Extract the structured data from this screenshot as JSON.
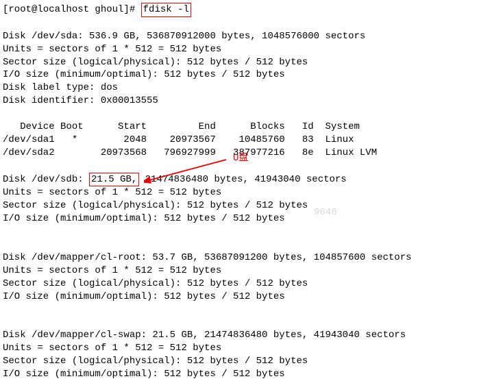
{
  "prompt": {
    "user_host": "[root@localhost ghoul]#",
    "command": "fdisk -l"
  },
  "disk_sda": {
    "header": "Disk /dev/sda: 536.9 GB, 536870912000 bytes, 1048576000 sectors",
    "units": "Units = sectors of 1 * 512 = 512 bytes",
    "sector_size": "Sector size (logical/physical): 512 bytes / 512 bytes",
    "io_size": "I/O size (minimum/optimal): 512 bytes / 512 bytes",
    "label_type": "Disk label type: dos",
    "identifier": "Disk identifier: 0x00013555"
  },
  "partition_table": {
    "header": "   Device Boot      Start         End      Blocks   Id  System",
    "rows": [
      "/dev/sda1   *        2048    20973567    10485760   83  Linux",
      "/dev/sda2        20973568   796927999   387977216   8e  Linux LVM"
    ]
  },
  "disk_sdb": {
    "header_prefix": "Disk /dev/sdb: ",
    "size_highlight": "21.5 GB,",
    "header_suffix": " 21474836480 bytes, 41943040 sectors",
    "units": "Units = sectors of 1 * 512 = 512 bytes",
    "sector_size": "Sector size (logical/physical): 512 bytes / 512 bytes",
    "io_size": "I/O size (minimum/optimal): 512 bytes / 512 bytes"
  },
  "disk_mapper_root": {
    "header": "Disk /dev/mapper/cl-root: 53.7 GB, 53687091200 bytes, 104857600 sectors",
    "units": "Units = sectors of 1 * 512 = 512 bytes",
    "sector_size": "Sector size (logical/physical): 512 bytes / 512 bytes",
    "io_size": "I/O size (minimum/optimal): 512 bytes / 512 bytes"
  },
  "disk_mapper_swap": {
    "header": "Disk /dev/mapper/cl-swap: 21.5 GB, 21474836480 bytes, 41943040 sectors",
    "units": "Units = sectors of 1 * 512 = 512 bytes",
    "sector_size": "Sector size (logical/physical): 512 bytes / 512 bytes",
    "io_size": "I/O size (minimum/optimal): 512 bytes / 512 bytes"
  },
  "annotations": {
    "u_disk": "U盘",
    "watermark": "9646"
  }
}
